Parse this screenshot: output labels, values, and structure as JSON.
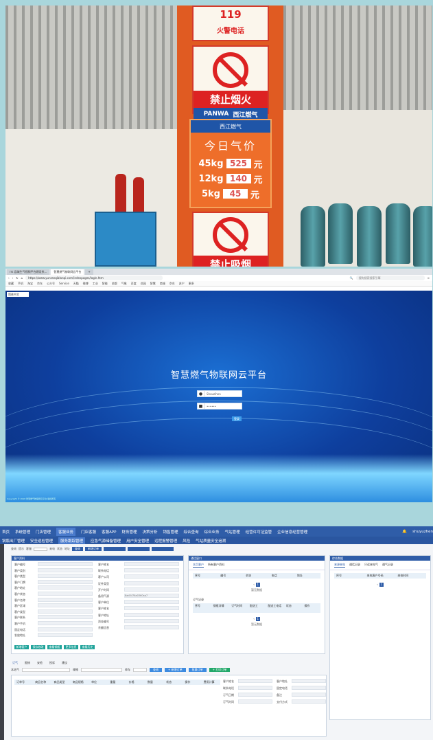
{
  "photo": {
    "emergency_number": "119",
    "emergency_label": "火警电话",
    "sign_no_fire": "禁止烟火",
    "brand_left": "PANWA",
    "brand_right": "西江燃气",
    "price_company": "西江燃气",
    "price_title": "今日气价",
    "prices": [
      {
        "size": "45kg",
        "value": "525",
        "unit": "元"
      },
      {
        "size": "12kg",
        "value": "140",
        "unit": "元"
      },
      {
        "size": "5kg",
        "value": "45",
        "unit": "元"
      }
    ],
    "sign_no_smoking": "禁止吸烟"
  },
  "browser": {
    "tabs": [
      "rrs 县城生气视频平台建设系...",
      "智慧燃气物联网云平台"
    ],
    "url": "https://www.yunranqiblanqi.com/indexpages/login.htm",
    "search_placeholder": "搜狗搜索搜索引擎",
    "bookmarks": [
      "收藏",
      "手机",
      "淘宝",
      "京东",
      "公众号",
      "Service",
      "天猫",
      "微博",
      "工业",
      "智能",
      "花都",
      "气象",
      "百度",
      "花园",
      "智慧",
      "商城",
      "京东",
      "苏宁",
      "更多"
    ],
    "language": "简体中文",
    "platform_title": "智慧燃气物联网云平台",
    "username": "Shouzihen",
    "password": "••••••",
    "login_button": "登录",
    "footer": "Copyright © 2018 智慧燃气物联网云平台 版权所有"
  },
  "admin": {
    "nav1": [
      "首页",
      "系统管理",
      "门店管理",
      "客服业务",
      "门店客服",
      "客服APP",
      "财务管理",
      "决策分析",
      "销售管理",
      "综合查询",
      "综合业务",
      "气站管理",
      "经营许可证监管",
      "企业信息经营管理"
    ],
    "nav1_active": 3,
    "user_name": "shuyuzhen",
    "nav2": [
      "钢瓶出厂管理",
      "安全巡检管理",
      "服务跟踪管理",
      "应急气源储备管理",
      "用户安全管理",
      "远程报警管理",
      "风险",
      "气站质量安全追溯"
    ],
    "nav2_active": 2,
    "toolbar_labels": [
      "查询",
      "提示",
      "客服",
      "来电",
      "状态",
      "地址"
    ],
    "toolbar_buttons": [
      "查询",
      "新增订单"
    ],
    "customer_panel": {
      "title": "客户资料",
      "left_labels": [
        "客户编号",
        "客户类别",
        "客户类型",
        "客户门牌",
        "客户地址",
        "客户状态",
        "客户名称",
        "客户区域",
        "客户类型",
        "客户联系",
        "客户手机",
        "固定电话",
        "发放地址"
      ],
      "right_labels": [
        "客户姓名",
        "联系电话",
        "客户公司",
        "证件类型",
        "开户时间",
        "备用气源",
        "客户单位",
        "客户姓名",
        "客户地址",
        "资金编号",
        "余额信息"
      ],
      "prefill": "8ad5476a0360aa7",
      "buttons": [
        "新增客户",
        "保存修改",
        "查看钢瓶",
        "更多信息",
        "查看历史"
      ]
    },
    "call_panel": {
      "title": "通话窗口",
      "tabs": [
        "本页客户",
        "所有客户资料"
      ],
      "head": [
        "序号",
        "编号",
        "姓名",
        "电话",
        "地址"
      ],
      "empty": "暂无数据",
      "section2": "订气记录",
      "head2": [
        "序号",
        "钢瓶详情",
        "订气时间",
        "配送工",
        "配送工电话",
        "状态",
        "操作"
      ]
    },
    "right_panel": {
      "title": "综合数据",
      "tabs": [
        "来源来电",
        "通话记录",
        "只读来电气",
        "通气记录"
      ],
      "head": [
        "序号",
        "来电客户号码",
        "来电时间"
      ]
    },
    "bottom_tabs": [
      "订气",
      "报修",
      "安检",
      "投诉",
      "建议"
    ],
    "order_line": {
      "station": "本站气",
      "label": "规格",
      "stock_label": "库存",
      "btn_query": "查询",
      "btn_create": "+ 新增订单",
      "btn_batch": "批量订单",
      "btn_print": "+ 打印订单"
    },
    "order_head": [
      "订单号",
      "商品名称",
      "商品类型",
      "商品规格",
      "单位",
      "重量",
      "价格",
      "数量",
      "状态",
      "操作",
      "费用计算"
    ],
    "side_form": [
      "客户姓名",
      "客户地址",
      "联系电话",
      "固定电话",
      "订气日期",
      "备注",
      "订气时间",
      "支付方式"
    ]
  }
}
